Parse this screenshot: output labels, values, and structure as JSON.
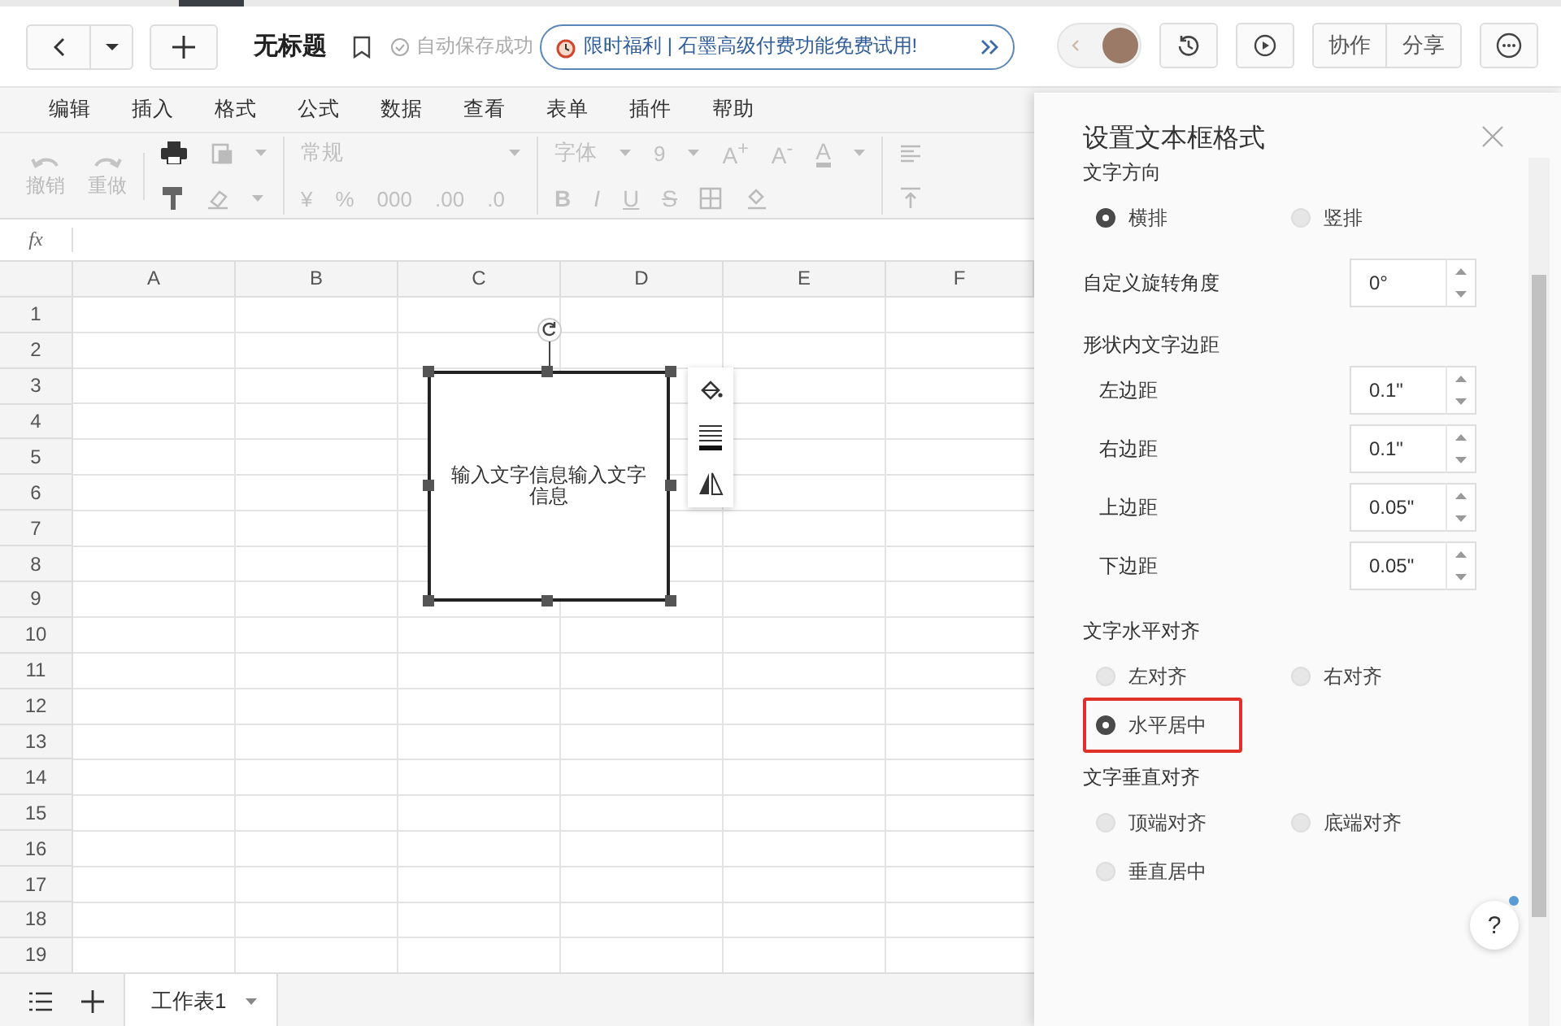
{
  "header": {
    "title": "无标题",
    "save_status": "自动保存成功",
    "promo": "限时福利 | 石墨高级付费功能免费试用!",
    "buttons": [
      "协作",
      "分享"
    ]
  },
  "menu": [
    "编辑",
    "插入",
    "格式",
    "公式",
    "数据",
    "查看",
    "表单",
    "插件",
    "帮助"
  ],
  "toolbar": {
    "undo": "撤销",
    "redo": "重做",
    "number_format": "常规",
    "font": "字体",
    "font_size": "9",
    "size_buttons": [
      "A$^{+}$",
      "A$^{-}$"
    ],
    "font_color": "A",
    "format_symbols": [
      "¥",
      "%",
      "000",
      ".00",
      ".0"
    ],
    "styles": [
      "B",
      "I",
      "U",
      "S"
    ]
  },
  "formula_bar": {
    "label": "fx"
  },
  "sheet": {
    "columns": [
      "A",
      "B",
      "C",
      "D",
      "E",
      "F"
    ],
    "rows": [
      "1",
      "2",
      "3",
      "4",
      "5",
      "6",
      "7",
      "8",
      "9",
      "10",
      "11",
      "12",
      "13",
      "14",
      "15",
      "16",
      "17",
      "18",
      "19"
    ]
  },
  "text_box": {
    "text": "输入文字信息输入文字信息"
  },
  "sheet_tabs": [
    {
      "label": "工作表1",
      "selected": true
    }
  ],
  "panel": {
    "title": "设置文本框格式",
    "sections": [
      {
        "kind": "radios",
        "label": "文字方向",
        "options": [
          {
            "label": "横排",
            "selected": true,
            "highlighted": false
          },
          {
            "label": "竖排",
            "selected": false,
            "highlighted": false
          }
        ]
      },
      {
        "kind": "spinner",
        "label": "自定义旋转角度",
        "value": "0°"
      },
      {
        "kind": "spinners",
        "label": "形状内文字边距",
        "fields": [
          {
            "label": "左边距",
            "value": "0.1\""
          },
          {
            "label": "右边距",
            "value": "0.1\""
          },
          {
            "label": "上边距",
            "value": "0.05\""
          },
          {
            "label": "下边距",
            "value": "0.05\""
          }
        ]
      },
      {
        "kind": "radios",
        "label": "文字水平对齐",
        "options": [
          {
            "label": "左对齐",
            "selected": false,
            "highlighted": false
          },
          {
            "label": "右对齐",
            "selected": false,
            "highlighted": false
          },
          {
            "label": "水平居中",
            "selected": true,
            "highlighted": true
          }
        ]
      },
      {
        "kind": "radios",
        "label": "文字垂直对齐",
        "options": [
          {
            "label": "顶端对齐",
            "selected": false,
            "highlighted": false
          },
          {
            "label": "底端对齐",
            "selected": false,
            "highlighted": false
          },
          {
            "label": "垂直居中",
            "selected": false,
            "highlighted": false
          }
        ]
      }
    ],
    "help": "?"
  }
}
